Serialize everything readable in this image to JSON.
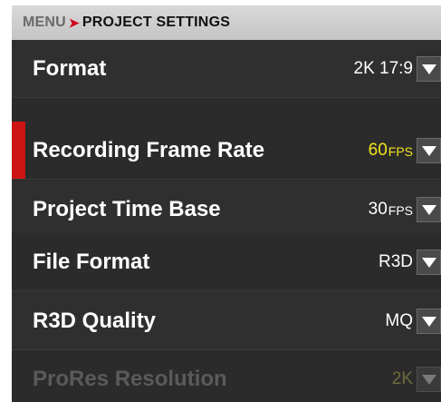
{
  "breadcrumb": {
    "root": "MENU",
    "separator": "➤",
    "current": "PROJECT SETTINGS"
  },
  "settings": [
    {
      "label": "Format",
      "value": "2K 17:9",
      "unit": "",
      "state": "normal"
    },
    {
      "label": "Recording Frame Rate",
      "value": "60",
      "unit": "FPS",
      "state": "selected"
    },
    {
      "label": "Project Time Base",
      "value": "30",
      "unit": "FPS",
      "state": "normal"
    },
    {
      "label": "File Format",
      "value": "R3D",
      "unit": "",
      "state": "normal"
    },
    {
      "label": "R3D Quality",
      "value": "MQ",
      "unit": "",
      "state": "normal"
    },
    {
      "label": "ProRes Resolution",
      "value": "2K",
      "unit": "",
      "state": "disabled"
    }
  ],
  "colors": {
    "accent_red": "#cc1414",
    "selected_value": "#f2e41e",
    "row_background": "#2f2f2f"
  },
  "icons": {
    "dropdown": "chevron-down-icon",
    "breadcrumb_separator": "arrow-right-icon"
  }
}
